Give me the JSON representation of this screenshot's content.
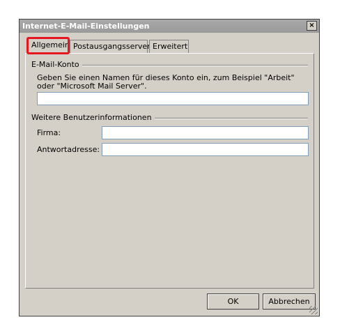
{
  "window": {
    "title": "Internet-E-Mail-Einstellungen",
    "close_glyph": "×"
  },
  "tabs": [
    {
      "label": "Allgemein",
      "active": true
    },
    {
      "label": "Postausgangsserver",
      "active": false
    },
    {
      "label": "Erweitert",
      "active": false
    }
  ],
  "mail_account": {
    "group_label": "E-Mail-Konto",
    "description": "Geben Sie einen Namen für dieses Konto ein, zum Beispiel \"Arbeit\" oder \"Microsoft Mail Server\".",
    "account_name_value": ""
  },
  "user_info": {
    "group_label": "Weitere Benutzerinformationen",
    "company_label": "Firma:",
    "company_value": "",
    "reply_label": "Antwortadresse:",
    "reply_value": ""
  },
  "buttons": {
    "ok": "OK",
    "cancel": "Abbrechen"
  },
  "colors": {
    "highlight": "#e5161f",
    "dialog_bg": "#d4d0c8",
    "titlebar": "#9f9f9f"
  }
}
